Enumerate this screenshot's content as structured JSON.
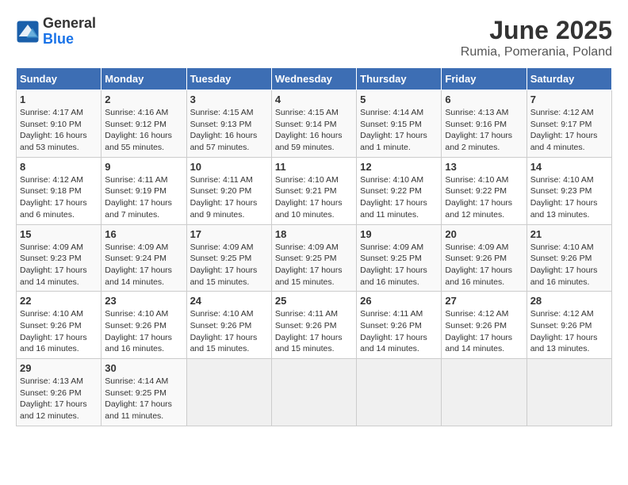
{
  "header": {
    "logo_general": "General",
    "logo_blue": "Blue",
    "title": "June 2025",
    "subtitle": "Rumia, Pomerania, Poland"
  },
  "calendar": {
    "columns": [
      "Sunday",
      "Monday",
      "Tuesday",
      "Wednesday",
      "Thursday",
      "Friday",
      "Saturday"
    ],
    "weeks": [
      [
        {
          "day": "",
          "info": ""
        },
        {
          "day": "2",
          "info": "Sunrise: 4:16 AM\nSunset: 9:12 PM\nDaylight: 16 hours\nand 55 minutes."
        },
        {
          "day": "3",
          "info": "Sunrise: 4:15 AM\nSunset: 9:13 PM\nDaylight: 16 hours\nand 57 minutes."
        },
        {
          "day": "4",
          "info": "Sunrise: 4:15 AM\nSunset: 9:14 PM\nDaylight: 16 hours\nand 59 minutes."
        },
        {
          "day": "5",
          "info": "Sunrise: 4:14 AM\nSunset: 9:15 PM\nDaylight: 17 hours\nand 1 minute."
        },
        {
          "day": "6",
          "info": "Sunrise: 4:13 AM\nSunset: 9:16 PM\nDaylight: 17 hours\nand 2 minutes."
        },
        {
          "day": "7",
          "info": "Sunrise: 4:12 AM\nSunset: 9:17 PM\nDaylight: 17 hours\nand 4 minutes."
        }
      ],
      [
        {
          "day": "1",
          "info": "Sunrise: 4:17 AM\nSunset: 9:10 PM\nDaylight: 16 hours\nand 53 minutes.",
          "pre": true
        },
        {
          "day": "8",
          "info": "Sunrise: 4:12 AM\nSunset: 9:18 PM\nDaylight: 17 hours\nand 6 minutes."
        },
        {
          "day": "9",
          "info": "Sunrise: 4:11 AM\nSunset: 9:19 PM\nDaylight: 17 hours\nand 7 minutes."
        },
        {
          "day": "10",
          "info": "Sunrise: 4:11 AM\nSunset: 9:20 PM\nDaylight: 17 hours\nand 9 minutes."
        },
        {
          "day": "11",
          "info": "Sunrise: 4:10 AM\nSunset: 9:21 PM\nDaylight: 17 hours\nand 10 minutes."
        },
        {
          "day": "12",
          "info": "Sunrise: 4:10 AM\nSunset: 9:22 PM\nDaylight: 17 hours\nand 11 minutes."
        },
        {
          "day": "13",
          "info": "Sunrise: 4:10 AM\nSunset: 9:22 PM\nDaylight: 17 hours\nand 12 minutes."
        },
        {
          "day": "14",
          "info": "Sunrise: 4:10 AM\nSunset: 9:23 PM\nDaylight: 17 hours\nand 13 minutes."
        }
      ],
      [
        {
          "day": "15",
          "info": "Sunrise: 4:09 AM\nSunset: 9:23 PM\nDaylight: 17 hours\nand 14 minutes."
        },
        {
          "day": "16",
          "info": "Sunrise: 4:09 AM\nSunset: 9:24 PM\nDaylight: 17 hours\nand 14 minutes."
        },
        {
          "day": "17",
          "info": "Sunrise: 4:09 AM\nSunset: 9:25 PM\nDaylight: 17 hours\nand 15 minutes."
        },
        {
          "day": "18",
          "info": "Sunrise: 4:09 AM\nSunset: 9:25 PM\nDaylight: 17 hours\nand 15 minutes."
        },
        {
          "day": "19",
          "info": "Sunrise: 4:09 AM\nSunset: 9:25 PM\nDaylight: 17 hours\nand 16 minutes."
        },
        {
          "day": "20",
          "info": "Sunrise: 4:09 AM\nSunset: 9:26 PM\nDaylight: 17 hours\nand 16 minutes."
        },
        {
          "day": "21",
          "info": "Sunrise: 4:10 AM\nSunset: 9:26 PM\nDaylight: 17 hours\nand 16 minutes."
        }
      ],
      [
        {
          "day": "22",
          "info": "Sunrise: 4:10 AM\nSunset: 9:26 PM\nDaylight: 17 hours\nand 16 minutes."
        },
        {
          "day": "23",
          "info": "Sunrise: 4:10 AM\nSunset: 9:26 PM\nDaylight: 17 hours\nand 16 minutes."
        },
        {
          "day": "24",
          "info": "Sunrise: 4:10 AM\nSunset: 9:26 PM\nDaylight: 17 hours\nand 15 minutes."
        },
        {
          "day": "25",
          "info": "Sunrise: 4:11 AM\nSunset: 9:26 PM\nDaylight: 17 hours\nand 15 minutes."
        },
        {
          "day": "26",
          "info": "Sunrise: 4:11 AM\nSunset: 9:26 PM\nDaylight: 17 hours\nand 14 minutes."
        },
        {
          "day": "27",
          "info": "Sunrise: 4:12 AM\nSunset: 9:26 PM\nDaylight: 17 hours\nand 14 minutes."
        },
        {
          "day": "28",
          "info": "Sunrise: 4:12 AM\nSunset: 9:26 PM\nDaylight: 17 hours\nand 13 minutes."
        }
      ],
      [
        {
          "day": "29",
          "info": "Sunrise: 4:13 AM\nSunset: 9:26 PM\nDaylight: 17 hours\nand 12 minutes."
        },
        {
          "day": "30",
          "info": "Sunrise: 4:14 AM\nSunset: 9:25 PM\nDaylight: 17 hours\nand 11 minutes."
        },
        {
          "day": "",
          "info": ""
        },
        {
          "day": "",
          "info": ""
        },
        {
          "day": "",
          "info": ""
        },
        {
          "day": "",
          "info": ""
        },
        {
          "day": "",
          "info": ""
        }
      ]
    ]
  }
}
